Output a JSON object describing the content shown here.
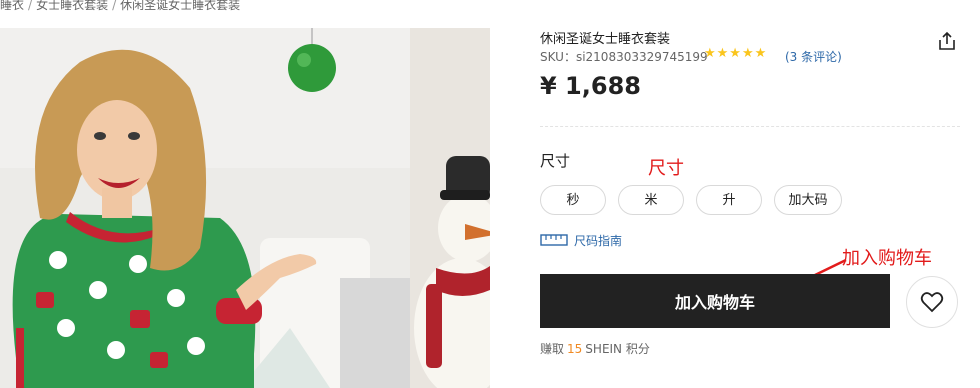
{
  "breadcrumb": {
    "items": [
      "睡衣",
      "女士睡衣套装",
      "休闲圣诞女士睡衣套装"
    ],
    "separator": "/"
  },
  "product": {
    "title": "休闲圣诞女士睡衣套装",
    "sku_label": "SKU：",
    "sku_value": "si2108303329745199",
    "rating_stars": "★★★★★",
    "rating_value": 5,
    "reviews_text": "(3 条评论)",
    "price": "¥ 1,688",
    "image_icon": "christmas-pajama-model-photo"
  },
  "size": {
    "label": "尺寸",
    "annotation": "尺寸",
    "options": [
      "秒",
      "米",
      "升",
      "加大码"
    ],
    "guide_label": "尺码指南"
  },
  "cart": {
    "annotation": "加入购物车",
    "button_label": "加入购物车"
  },
  "points": {
    "prefix": "赚取",
    "amount": "15",
    "suffix": "SHEIN 积分"
  },
  "icons": {
    "share": "share-icon",
    "heart": "heart-icon",
    "ruler": "ruler-icon",
    "annotation_arrow": "red-arrow-icon"
  },
  "colors": {
    "annotation_red": "#e21b1b",
    "link_blue": "#2d68a8",
    "star_yellow": "#fac51d",
    "button_black": "#222222",
    "points_orange": "#f08a24"
  }
}
